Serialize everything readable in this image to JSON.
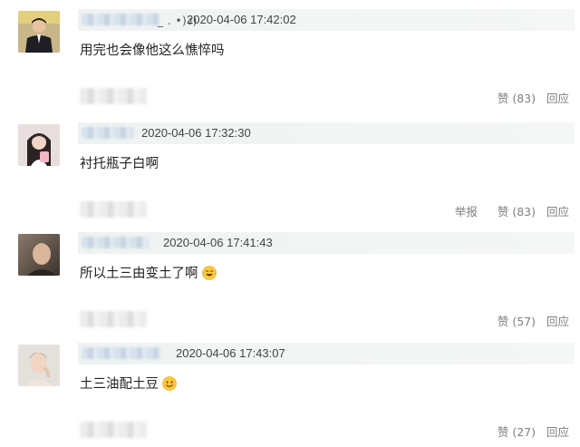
{
  "comments": [
    {
      "name_suffix": "_ . •)ง)",
      "timestamp": "2020-04-06 17:42:02",
      "text": "用完也会像他这么憔悴吗",
      "report_label": "",
      "like_label": "赞 (83)",
      "reply_label": "回应",
      "avatar_icon": "man-in-suit-avatar",
      "emoji": ""
    },
    {
      "name_suffix": "",
      "timestamp": "2020-04-06 17:32:30",
      "text": "衬托瓶子白啊",
      "report_label": "举报",
      "like_label": "赞 (83)",
      "reply_label": "回应",
      "avatar_icon": "girl-avatar",
      "emoji": ""
    },
    {
      "name_suffix": "",
      "timestamp": "2020-04-06 17:41:43",
      "text": "所以土三由变土了啊",
      "report_label": "",
      "like_label": "赞 (57)",
      "reply_label": "回应",
      "avatar_icon": "man-portrait-avatar",
      "emoji": "laughing-tears-emoji"
    },
    {
      "name_suffix": "",
      "timestamp": "2020-04-06 17:43:07",
      "text": "土三油配土豆",
      "report_label": "",
      "like_label": "赞 (27)",
      "reply_label": "回应",
      "avatar_icon": "young-man-avatar",
      "emoji": "smile-emoji"
    }
  ]
}
